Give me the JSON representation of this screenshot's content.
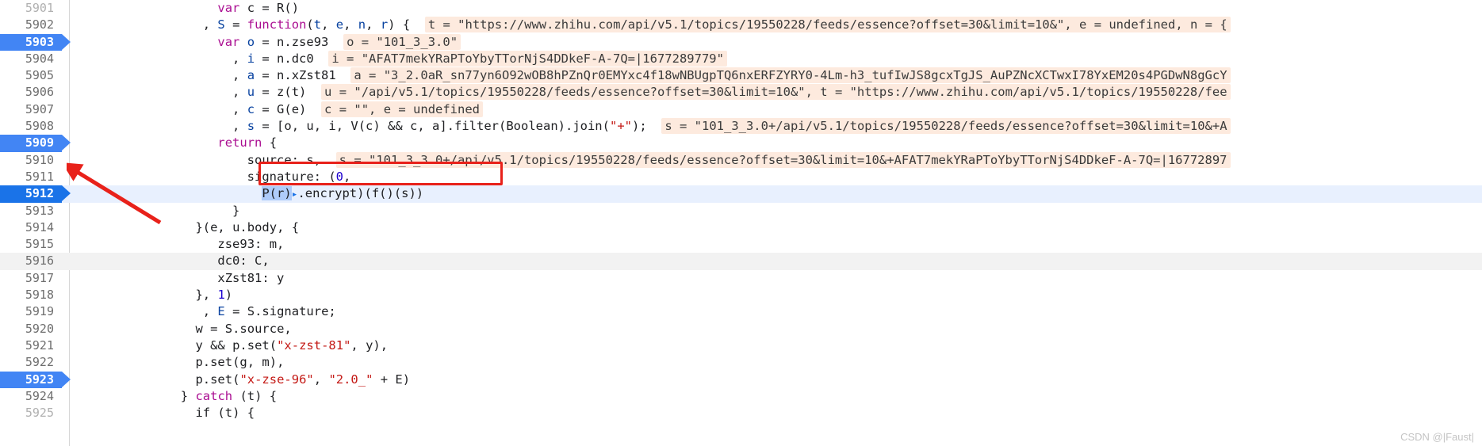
{
  "app": {
    "kind": "chrome-devtools-sources-debugger",
    "watermark": "CSDN @|Faust|"
  },
  "colors": {
    "accent_blue": "#4285f4",
    "current_line_blue": "#1a73e8",
    "exec_line_bg": "#e8f0fe",
    "inline_value_bg": "#fdeade",
    "annotation_red": "#e8211a",
    "selection_blue": "#aecbfa",
    "string_red": "#c41a16",
    "keyword_magenta": "#aa0d91",
    "identifier_blue": "#0842a0"
  },
  "editor": {
    "first_line_number": 5901,
    "current_line": 5912,
    "breakpoint_lines": [
      5903,
      5909,
      5912,
      5923
    ],
    "hover_line": 5916,
    "lines": [
      {
        "num": "5901",
        "indent": 20,
        "segments": [
          {
            "t": "var ",
            "c": "kw"
          },
          {
            "t": "c = R()",
            "c": "pln"
          }
        ]
      },
      {
        "num": "5902",
        "indent": 18,
        "segments": [
          {
            "t": ", ",
            "c": "pln"
          },
          {
            "t": "S",
            "c": "var"
          },
          {
            "t": " = ",
            "c": "pln"
          },
          {
            "t": "function",
            "c": "kw"
          },
          {
            "t": "(",
            "c": "pln"
          },
          {
            "t": "t",
            "c": "var"
          },
          {
            "t": ", ",
            "c": "pln"
          },
          {
            "t": "e",
            "c": "var"
          },
          {
            "t": ", ",
            "c": "pln"
          },
          {
            "t": "n",
            "c": "var"
          },
          {
            "t": ", ",
            "c": "pln"
          },
          {
            "t": "r",
            "c": "var"
          },
          {
            "t": ") {",
            "c": "pln"
          },
          {
            "t": "  ",
            "c": "pln"
          },
          {
            "t": "t = \"https://www.zhihu.com/api/v5.1/topics/19550228/feeds/essence?offset=30&limit=10&\", e = undefined, n = {",
            "c": "val"
          }
        ]
      },
      {
        "num": "5903",
        "indent": 20,
        "segments": [
          {
            "t": "var ",
            "c": "kw"
          },
          {
            "t": "o",
            "c": "var"
          },
          {
            "t": " = n.zse93",
            "c": "pln"
          },
          {
            "t": "  ",
            "c": "pln"
          },
          {
            "t": "o = \"101_3_3.0\"",
            "c": "val"
          }
        ]
      },
      {
        "num": "5904",
        "indent": 22,
        "segments": [
          {
            "t": ", ",
            "c": "pln"
          },
          {
            "t": "i",
            "c": "var"
          },
          {
            "t": " = n.dc0",
            "c": "pln"
          },
          {
            "t": "  ",
            "c": "pln"
          },
          {
            "t": "i = \"AFAT7mekYRaPToYbyTTorNjS4DDkeF-A-7Q=|1677289779\"",
            "c": "val"
          }
        ]
      },
      {
        "num": "5905",
        "indent": 22,
        "segments": [
          {
            "t": ", ",
            "c": "pln"
          },
          {
            "t": "a",
            "c": "var"
          },
          {
            "t": " = n.xZst81",
            "c": "pln"
          },
          {
            "t": "  ",
            "c": "pln"
          },
          {
            "t": "a = \"3_2.0aR_sn77yn6O92wOB8hPZnQr0EMYxc4f18wNBUgpTQ6nxERFZYRY0-4Lm-h3_tufIwJS8gcxTgJS_AuPZNcXCTwxI78YxEM20s4PGDwN8gGcY",
            "c": "val"
          }
        ]
      },
      {
        "num": "5906",
        "indent": 22,
        "segments": [
          {
            "t": ", ",
            "c": "pln"
          },
          {
            "t": "u",
            "c": "var"
          },
          {
            "t": " = z(t)",
            "c": "pln"
          },
          {
            "t": "  ",
            "c": "pln"
          },
          {
            "t": "u = \"/api/v5.1/topics/19550228/feeds/essence?offset=30&limit=10&\", t = \"https://www.zhihu.com/api/v5.1/topics/19550228/fee",
            "c": "val"
          }
        ]
      },
      {
        "num": "5907",
        "indent": 22,
        "segments": [
          {
            "t": ", ",
            "c": "pln"
          },
          {
            "t": "c",
            "c": "var"
          },
          {
            "t": " = G(e)",
            "c": "pln"
          },
          {
            "t": "  ",
            "c": "pln"
          },
          {
            "t": "c = \"\", e = undefined",
            "c": "val"
          }
        ]
      },
      {
        "num": "5908",
        "indent": 22,
        "segments": [
          {
            "t": ", ",
            "c": "pln"
          },
          {
            "t": "s",
            "c": "var"
          },
          {
            "t": " = [o, u, i, V(c) && c, a].filter(Boolean).join(",
            "c": "pln"
          },
          {
            "t": "\"+\"",
            "c": "str"
          },
          {
            "t": ");",
            "c": "pln"
          },
          {
            "t": "  ",
            "c": "pln"
          },
          {
            "t": "s = \"101_3_3.0+/api/v5.1/topics/19550228/feeds/essence?offset=30&limit=10&+A",
            "c": "val"
          }
        ]
      },
      {
        "num": "5909",
        "indent": 20,
        "segments": [
          {
            "t": "return",
            "c": "kw"
          },
          {
            "t": " {",
            "c": "pln"
          }
        ]
      },
      {
        "num": "5910",
        "indent": 24,
        "segments": [
          {
            "t": "source: s,",
            "c": "pln"
          },
          {
            "t": "  ",
            "c": "pln"
          },
          {
            "t": "s = \"101_3_3.0+/api/v5.1/topics/19550228/feeds/essence?offset=30&limit=10&+AFAT7mekYRaPToYbyTTorNjS4DDkeF-A-7Q=|16772897",
            "c": "val"
          }
        ]
      },
      {
        "num": "5911",
        "indent": 24,
        "segments": [
          {
            "t": "signature: (",
            "c": "pln"
          },
          {
            "t": "0",
            "c": "num"
          },
          {
            "t": ",",
            "c": "pln"
          }
        ]
      },
      {
        "num": "5912",
        "indent": 26,
        "selected_text": "P(r)",
        "segments": [
          {
            "t": "P(r)",
            "c": "sel"
          },
          {
            "t": ".encrypt)",
            "c": "pln"
          },
          {
            "t": "(",
            "c": "pln"
          },
          {
            "t": "f()",
            "c": "pln"
          },
          {
            "t": "(s))",
            "c": "pln"
          }
        ]
      },
      {
        "num": "5913",
        "indent": 22,
        "segments": [
          {
            "t": "}",
            "c": "pln"
          }
        ]
      },
      {
        "num": "5914",
        "indent": 17,
        "segments": [
          {
            "t": "}(e, u.body, {",
            "c": "pln"
          }
        ]
      },
      {
        "num": "5915",
        "indent": 20,
        "segments": [
          {
            "t": "zse93: m,",
            "c": "pln"
          }
        ]
      },
      {
        "num": "5916",
        "indent": 20,
        "segments": [
          {
            "t": "dc0: C,",
            "c": "pln"
          }
        ]
      },
      {
        "num": "5917",
        "indent": 20,
        "segments": [
          {
            "t": "xZst81: y",
            "c": "pln"
          }
        ]
      },
      {
        "num": "5918",
        "indent": 17,
        "segments": [
          {
            "t": "}, ",
            "c": "pln"
          },
          {
            "t": "1",
            "c": "num"
          },
          {
            "t": ")",
            "c": "pln"
          }
        ]
      },
      {
        "num": "5919",
        "indent": 18,
        "segments": [
          {
            "t": ", ",
            "c": "pln"
          },
          {
            "t": "E",
            "c": "var"
          },
          {
            "t": " = S.signature;",
            "c": "pln"
          }
        ]
      },
      {
        "num": "5920",
        "indent": 17,
        "segments": [
          {
            "t": "w = S.source,",
            "c": "pln"
          }
        ]
      },
      {
        "num": "5921",
        "indent": 17,
        "segments": [
          {
            "t": "y && p.set(",
            "c": "pln"
          },
          {
            "t": "\"x-zst-81\"",
            "c": "str"
          },
          {
            "t": ", y),",
            "c": "pln"
          }
        ]
      },
      {
        "num": "5922",
        "indent": 17,
        "segments": [
          {
            "t": "p.set(g, m),",
            "c": "pln"
          }
        ]
      },
      {
        "num": "5923",
        "indent": 17,
        "segments": [
          {
            "t": "p.set(",
            "c": "pln"
          },
          {
            "t": "\"x-zse-96\"",
            "c": "str"
          },
          {
            "t": ", ",
            "c": "pln"
          },
          {
            "t": "\"2.0_\"",
            "c": "str"
          },
          {
            "t": " + E)",
            "c": "pln"
          }
        ]
      },
      {
        "num": "5924",
        "indent": 15,
        "segments": [
          {
            "t": "} ",
            "c": "pln"
          },
          {
            "t": "catch",
            "c": "kw"
          },
          {
            "t": " (t) {",
            "c": "pln"
          }
        ]
      },
      {
        "num": "5925",
        "indent": 17,
        "segments": [
          {
            "t": "if (t) {",
            "c": "pln"
          }
        ]
      }
    ]
  },
  "annotations": {
    "red_box_target_line": "5912",
    "red_arrow_points_to_line": "5912"
  }
}
